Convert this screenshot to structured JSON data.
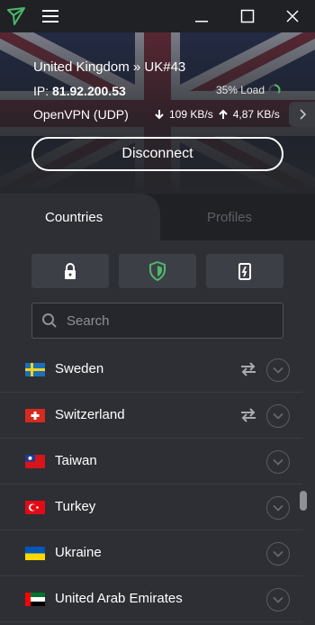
{
  "titlebar": {
    "icons": [
      "protonvpn-logo-icon",
      "hamburger-menu-icon",
      "minimize-icon",
      "maximize-icon",
      "close-icon"
    ]
  },
  "connection": {
    "server": "United Kingdom » UK#43",
    "ip_label": "IP:",
    "ip": "81.92.200.53",
    "load": "35% Load",
    "load_percent": 35,
    "protocol": "OpenVPN (UDP)",
    "download": "109 KB/s",
    "upload": "4,87 KB/s",
    "disconnect_label": "Disconnect"
  },
  "tabs": {
    "countries": "Countries",
    "profiles": "Profiles",
    "active": "Countries"
  },
  "filters": [
    "lock-icon",
    "shield-icon",
    "tor-icon"
  ],
  "search": {
    "placeholder": "Search"
  },
  "countries": [
    {
      "name": "Sweden",
      "p2p": true
    },
    {
      "name": "Switzerland",
      "p2p": true
    },
    {
      "name": "Taiwan",
      "p2p": false
    },
    {
      "name": "Turkey",
      "p2p": false
    },
    {
      "name": "Ukraine",
      "p2p": false
    },
    {
      "name": "United Arab Emirates",
      "p2p": false
    }
  ],
  "colors": {
    "accent_green": "#4cb86b",
    "background": "#25272c",
    "panel": "#2d2f35"
  }
}
